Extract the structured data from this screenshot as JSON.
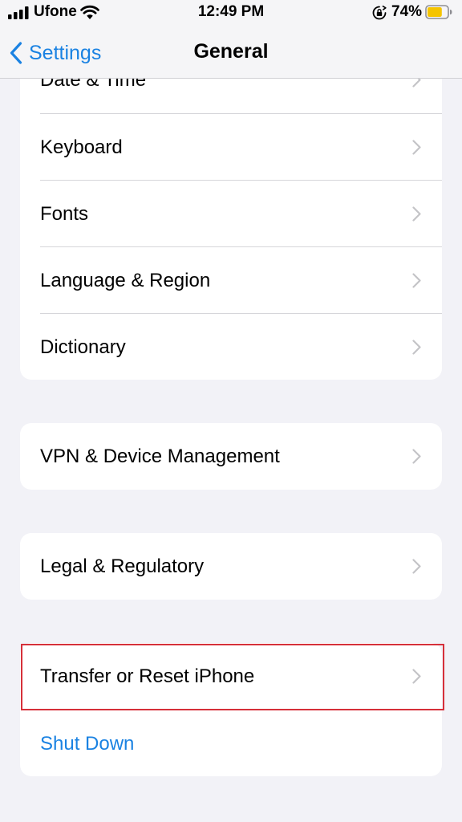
{
  "status_bar": {
    "carrier": "Ufone",
    "time": "12:49 PM",
    "battery_percent": "74%",
    "battery_level": 0.74,
    "battery_color": "#f5c400",
    "icons": [
      "signal-icon",
      "wifi-icon",
      "orientation-lock-icon",
      "battery-icon"
    ]
  },
  "nav": {
    "back_label": "Settings",
    "title": "General",
    "accent_color": "#1a82e2"
  },
  "groups": {
    "group1": {
      "items": [
        {
          "label": "Date & Time"
        },
        {
          "label": "Keyboard"
        },
        {
          "label": "Fonts"
        },
        {
          "label": "Language & Region"
        },
        {
          "label": "Dictionary"
        }
      ]
    },
    "group2": {
      "items": [
        {
          "label": "VPN & Device Management"
        }
      ]
    },
    "group3": {
      "items": [
        {
          "label": "Legal & Regulatory"
        }
      ]
    },
    "group4": {
      "items": [
        {
          "label": "Transfer or Reset iPhone"
        },
        {
          "label": "Shut Down"
        }
      ]
    }
  },
  "highlight_color": "#d6303a"
}
